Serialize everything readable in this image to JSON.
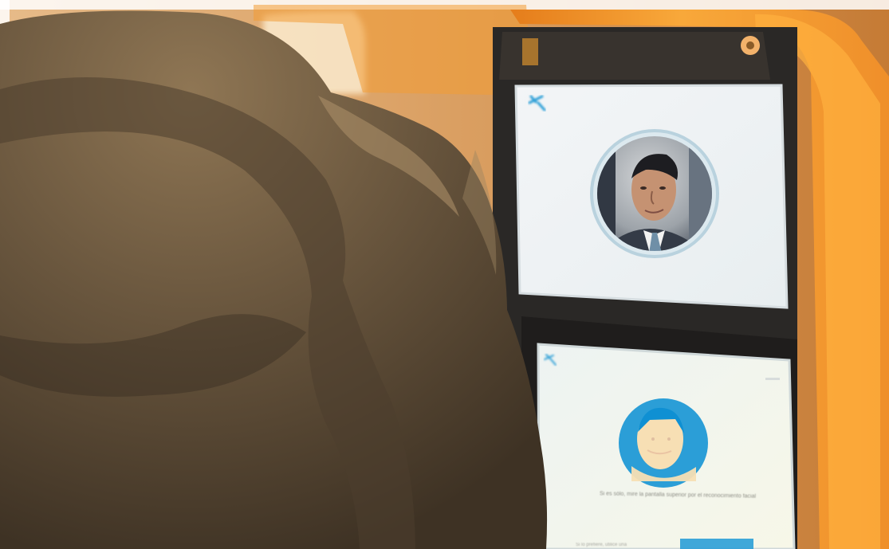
{
  "scene": {
    "type": "photograph",
    "subject": "Person standing at an orange ATM kiosk with facial recognition screens",
    "colors": {
      "kiosk_orange": "#f6a52f",
      "jacket_brown": "#5d4b34",
      "screen_white": "#f4f7f8",
      "accent_blue": "#2b9ed7",
      "dark_panel": "#2c2a28"
    },
    "screen_elements": {
      "top_screen_logo": "star-logo-icon",
      "top_screen_avatar": "portrait-circle",
      "bottom_screen_logo": "star-logo-icon",
      "bottom_screen_face_icon": "face-icon",
      "bottom_screen_prompt": "Si es sólo, mire la pantalla superior por el reconocimiento facial",
      "bottom_screen_small_text": "Si lo prefiere, utilice una",
      "bottom_screen_button": ""
    }
  }
}
